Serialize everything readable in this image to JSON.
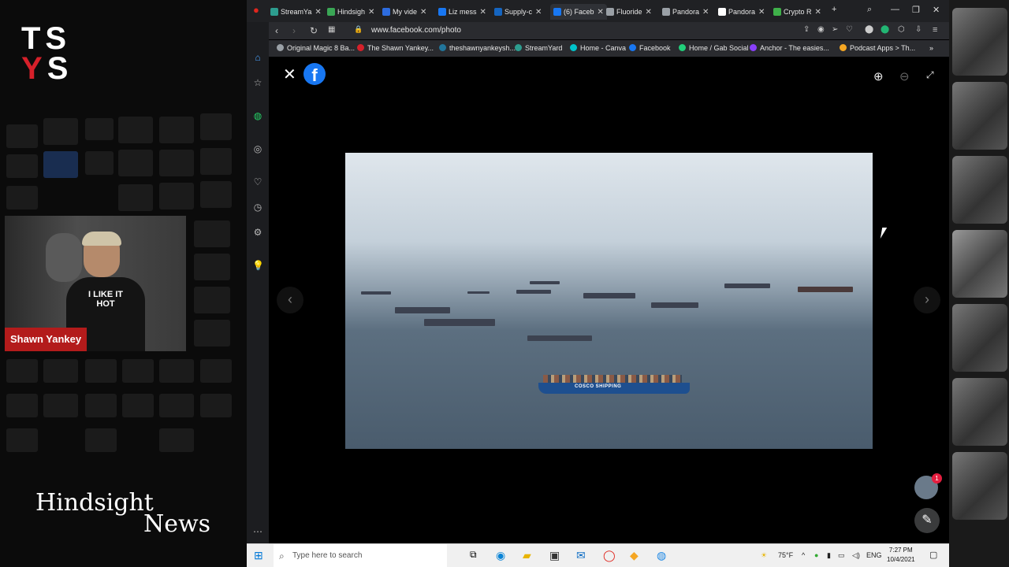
{
  "overlay": {
    "logo_line1": "TS",
    "logo_y": "Y",
    "logo_s": "S",
    "host_name": "Shawn Yankey",
    "shirt_text": "I LIKE IT HOT",
    "show_title_1": "Hindsight",
    "show_title_2": "News"
  },
  "browser": {
    "tabs": [
      {
        "label": "StreamYa",
        "color": "#2d9d8f"
      },
      {
        "label": "Hindsigh",
        "color": "#3aa655"
      },
      {
        "label": "My vide",
        "color": "#2d6cdf"
      },
      {
        "label": "Liz mess",
        "color": "#1877f2"
      },
      {
        "label": "Supply-c",
        "color": "#1565c0"
      },
      {
        "label": "(6) Faceb",
        "color": "#1877f2"
      },
      {
        "label": "Fluoride",
        "color": "#9aa0a6"
      },
      {
        "label": "Pandora",
        "color": "#9aa0a6"
      },
      {
        "label": "Pandora",
        "color": "#ffffff"
      },
      {
        "label": "Crypto R",
        "color": "#3fb04a"
      }
    ],
    "url": "www.facebook.com/photo",
    "bookmarks": [
      {
        "label": "Original Magic 8 Ba...",
        "color": "#9aa0a6"
      },
      {
        "label": "The Shawn Yankey...",
        "color": "#d6202a"
      },
      {
        "label": "theshawnyankeysh...",
        "color": "#21759b"
      },
      {
        "label": "StreamYard",
        "color": "#2d9d8f"
      },
      {
        "label": "Home - Canva",
        "color": "#00c4cc"
      },
      {
        "label": "Facebook",
        "color": "#1877f2"
      },
      {
        "label": "Home / Gab Social",
        "color": "#21cf7a"
      },
      {
        "label": "Anchor - The easies...",
        "color": "#8940fa"
      },
      {
        "label": "Podcast Apps > Th...",
        "color": "#f5a623"
      }
    ]
  },
  "viewer": {
    "close_icon": "close-icon",
    "brand": "f",
    "ship_text": "COSCO SHIPPING",
    "prev_icon": "chevron-left-icon",
    "next_icon": "chevron-right-icon",
    "notification_count": "1"
  },
  "taskbar": {
    "search_placeholder": "Type here to search",
    "weather": "75°F",
    "lang": "ENG",
    "time": "7:27 PM",
    "date": "10/4/2021"
  }
}
